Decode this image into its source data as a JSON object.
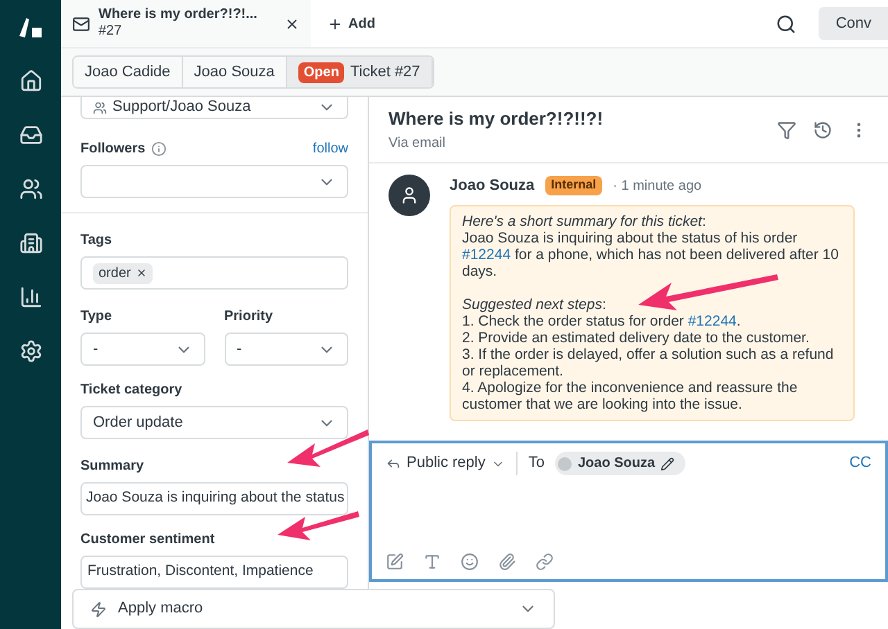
{
  "top_bar": {
    "tab": {
      "title": "Where is my order?!?!...",
      "number": "#27"
    },
    "add_label": "Add",
    "conv_button": "Conv"
  },
  "breadcrumbs": [
    {
      "label": "Joao Cadide"
    },
    {
      "label": "Joao Souza"
    },
    {
      "badge": "Open",
      "label": "Ticket #27"
    }
  ],
  "properties": {
    "assignee": "Support/Joao Souza",
    "followers": {
      "label": "Followers",
      "action": "follow"
    },
    "tags": {
      "label": "Tags",
      "items": [
        "order"
      ]
    },
    "type": {
      "label": "Type",
      "value": "-"
    },
    "priority": {
      "label": "Priority",
      "value": "-"
    },
    "ticket_category": {
      "label": "Ticket category",
      "value": "Order update"
    },
    "summary": {
      "label": "Summary",
      "value": "Joao Souza is inquiring about the status"
    },
    "customer_sentiment": {
      "label": "Customer sentiment",
      "value": "Frustration, Discontent, Impatience"
    }
  },
  "apply_macro": "Apply macro",
  "conversation": {
    "title": "Where is my order?!?!!?!",
    "via": "Via email",
    "message": {
      "author": "Joao Souza",
      "badge": "Internal",
      "separator": "·",
      "time": "1 minute ago",
      "summary_heading": "*Here's a short summary for this ticket*:",
      "summary": {
        "before": "Joao Souza is inquiring about the status of his order",
        "link": "#12244",
        "after": "for a phone, which has not been delivered after 10 days."
      },
      "steps_heading": "*Suggested next steps*:",
      "steps": [
        {
          "text": "1. Check the order status for order",
          "link": "#12244",
          "after": "."
        },
        {
          "text": "2. Provide an estimated delivery date to the customer."
        },
        {
          "text": "3. If the order is delayed, offer a solution such as a refund or replacement."
        },
        {
          "text": "4. Apologize for the inconvenience and reassure the customer that we are looking into the issue."
        }
      ]
    }
  },
  "reply": {
    "mode": "Public reply",
    "to_label": "To",
    "recipient": "Joao Souza",
    "cc": "CC"
  }
}
